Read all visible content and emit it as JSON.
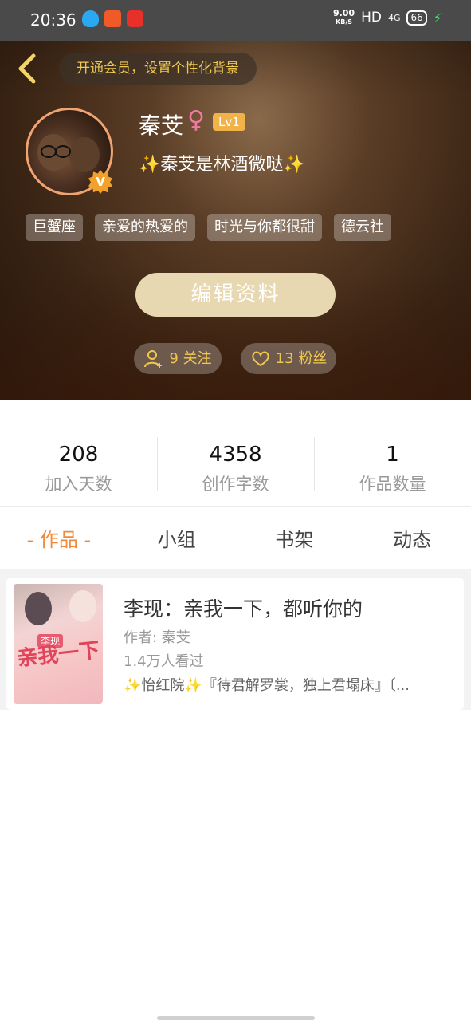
{
  "status_bar": {
    "time": "20:36",
    "net_speed": "9.00",
    "net_speed_unit": "KB/S",
    "hd": "HD",
    "signal": "4G",
    "battery": "66",
    "app_icons": [
      "qq-icon",
      "app-icon",
      "netease-music-icon"
    ]
  },
  "header": {
    "back_icon": "chevron-left-icon",
    "vip_banner": "开通会员，设置个性化背景"
  },
  "profile": {
    "username": "秦芠",
    "gender_symbol": "♀",
    "level": "Lv1",
    "verified_badge": "V",
    "signature": "✨秦芠是林酒微哒✨",
    "tags": [
      "巨蟹座",
      "亲爱的热爱的",
      "时光与你都很甜",
      "德云社"
    ],
    "edit_button": "编辑资料",
    "following": "9 关注",
    "followers": "13 粉丝"
  },
  "stats": [
    {
      "value": "208",
      "label": "加入天数"
    },
    {
      "value": "4358",
      "label": "创作字数"
    },
    {
      "value": "1",
      "label": "作品数量"
    }
  ],
  "tabs": [
    {
      "label": "- 作品 -",
      "active": true
    },
    {
      "label": "小组",
      "active": false
    },
    {
      "label": "书架",
      "active": false
    },
    {
      "label": "动态",
      "active": false
    }
  ],
  "works": [
    {
      "title": "李现：亲我一下，都听你的",
      "author": "作者: 秦芠",
      "views": "1.4万人看过",
      "description": "✨怡红院✨『待君解罗裳，独上君塌床』〔...",
      "cover_text": "亲我一下 都听你的",
      "cover_badge": "李现"
    }
  ],
  "colors": {
    "accent_orange": "#f08a3a",
    "gold": "#f1c84e",
    "edit_button_bg": "#e7d8b1",
    "level_badge": "#f1b348"
  }
}
